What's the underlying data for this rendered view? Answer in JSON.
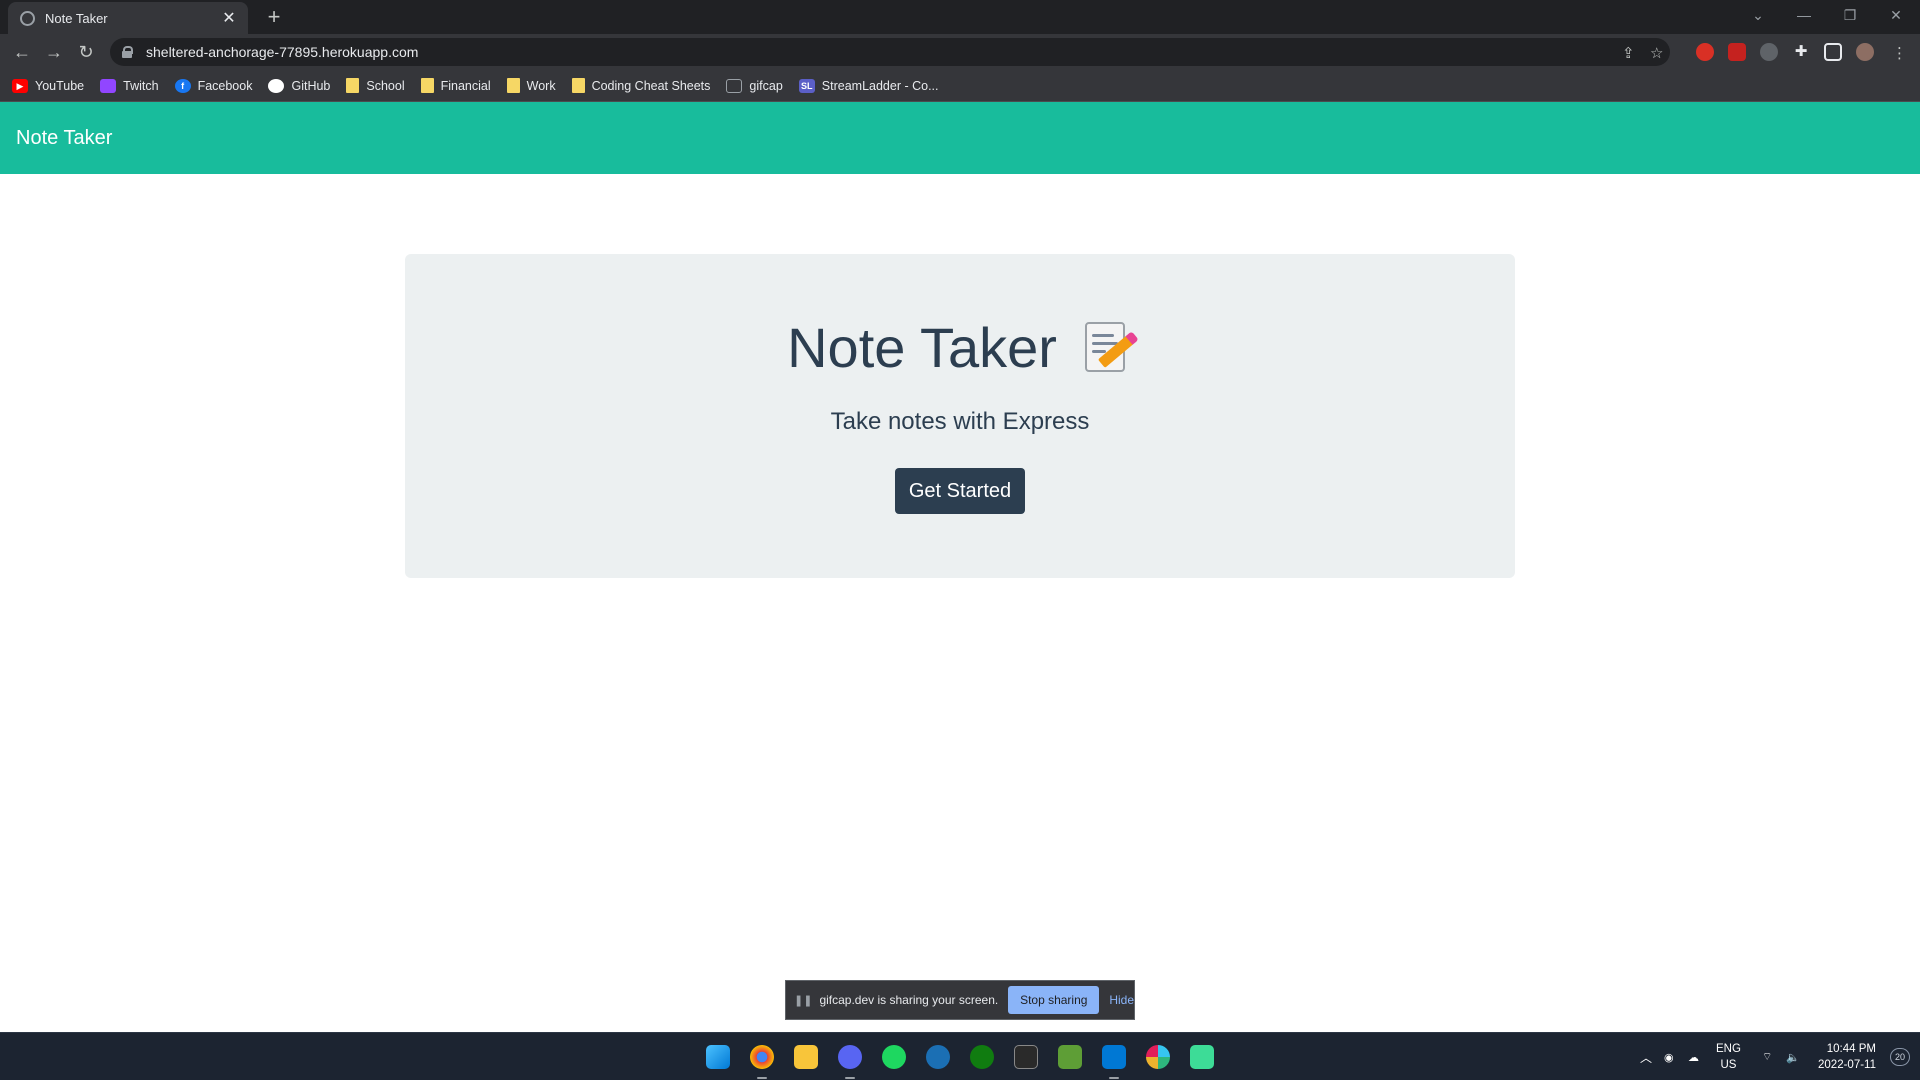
{
  "browser": {
    "tab_title": "Note Taker",
    "tab_close": "✕",
    "new_tab": "+",
    "url": "sheltered-anchorage-77895.herokuapp.com",
    "nav": {
      "back": "←",
      "forward": "→",
      "reload": "↻"
    },
    "window_controls": {
      "dropdown": "⌄",
      "minimize": "—",
      "restore": "❐",
      "close": "✕"
    },
    "bookmarks": [
      {
        "label": "YouTube",
        "icon": "youtube-icon",
        "color": "#ff0000"
      },
      {
        "label": "Twitch",
        "icon": "twitch-icon",
        "color": "#9146ff"
      },
      {
        "label": "Facebook",
        "icon": "facebook-icon",
        "color": "#1877f2"
      },
      {
        "label": "GitHub",
        "icon": "github-icon",
        "color": "#ffffff"
      },
      {
        "label": "School",
        "icon": "folder-icon",
        "color": "#f6d765"
      },
      {
        "label": "Financial",
        "icon": "folder-icon",
        "color": "#f6d765"
      },
      {
        "label": "Work",
        "icon": "folder-icon",
        "color": "#f6d765"
      },
      {
        "label": "Coding Cheat Sheets",
        "icon": "folder-icon",
        "color": "#f6d765"
      },
      {
        "label": "gifcap",
        "icon": "gifcap-icon",
        "color": "#9aa0a6"
      },
      {
        "label": "StreamLadder - Co...",
        "icon": "streamladder-icon",
        "color": "#5b5fc7"
      }
    ]
  },
  "navbar": {
    "brand": "Note Taker",
    "color": "#18bc9c"
  },
  "hero": {
    "title": "Note Taker",
    "subtitle": "Take notes with Express",
    "button": "Get Started",
    "button_color": "#2c3e50"
  },
  "share_bar": {
    "message": "gifcap.dev is sharing your screen.",
    "stop": "Stop sharing",
    "hide": "Hide"
  },
  "taskbar": {
    "apps": [
      "windows-start-icon",
      "chrome-icon",
      "file-explorer-icon",
      "discord-icon",
      "spotify-icon",
      "steam-icon",
      "xbox-icon",
      "epic-games-icon",
      "minecraft-icon",
      "vscode-icon",
      "slack-icon",
      "github-desktop-icon"
    ],
    "lang_top": "ENG",
    "lang_bottom": "US",
    "time": "10:44 PM",
    "date": "2022-07-11",
    "notifications": "20"
  }
}
